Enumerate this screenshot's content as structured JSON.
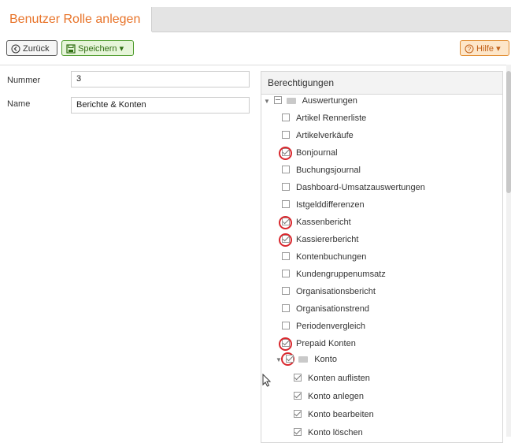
{
  "header": {
    "title": "Benutzer Rolle anlegen"
  },
  "toolbar": {
    "back_label": "Zurück",
    "save_label": "Speichern",
    "help_label": "Hilfe"
  },
  "form": {
    "number_label": "Nummer",
    "number_value": "3",
    "name_label": "Name",
    "name_value": "Berichte & Konten"
  },
  "permissions": {
    "title": "Berechtigungen",
    "group_auswertungen": "Auswertungen",
    "items": [
      {
        "label": "Artikel Rennerliste",
        "checked": false
      },
      {
        "label": "Artikelverkäufe",
        "checked": false
      },
      {
        "label": "Bonjournal",
        "checked": true
      },
      {
        "label": "Buchungsjournal",
        "checked": false
      },
      {
        "label": "Dashboard-Umsatzauswertungen",
        "checked": false
      },
      {
        "label": "Istgelddifferenzen",
        "checked": false
      },
      {
        "label": "Kassenbericht",
        "checked": true
      },
      {
        "label": "Kassiererbericht",
        "checked": true
      },
      {
        "label": "Kontenbuchungen",
        "checked": false
      },
      {
        "label": "Kundengruppenumsatz",
        "checked": false
      },
      {
        "label": "Organisationsbericht",
        "checked": false
      },
      {
        "label": "Organisationstrend",
        "checked": false
      },
      {
        "label": "Periodenvergleich",
        "checked": false
      },
      {
        "label": "Prepaid Konten",
        "checked": true
      }
    ],
    "group_konto": "Konto",
    "konto_items": [
      {
        "label": "Konten auflisten",
        "checked": true
      },
      {
        "label": "Konto anlegen",
        "checked": true
      },
      {
        "label": "Konto bearbeiten",
        "checked": true
      },
      {
        "label": "Konto löschen",
        "checked": true
      }
    ]
  },
  "colors": {
    "accent": "#e8742a",
    "save": "#4c9a2a",
    "highlight": "#d9282e"
  }
}
